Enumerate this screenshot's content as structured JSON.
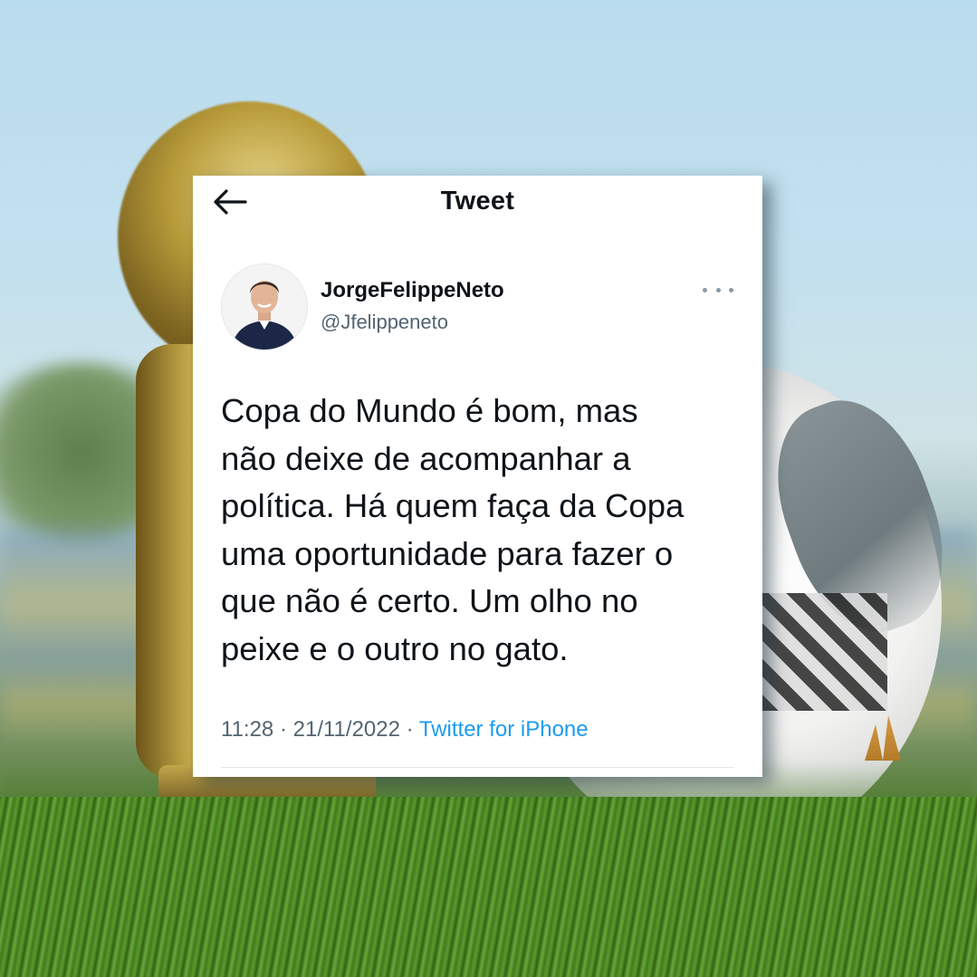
{
  "header": {
    "title": "Tweet"
  },
  "tweet": {
    "author_name": "JorgeFelippeNeto",
    "author_handle": "@Jfelippeneto",
    "text": "Copa do Mundo é bom, mas\nnão deixe de acompanhar a\npolítica. Há quem faça da Copa\numa oportunidade para fazer o\nque não é certo. Um olho no\npeixe e o outro no gato.",
    "time": "11:28",
    "date": "21/11/2022",
    "separator": "·",
    "source": "Twitter for iPhone"
  },
  "icons": {
    "back": "arrow-left-icon",
    "more": "more-horizontal-icon"
  },
  "colors": {
    "link": "#1d9bf0",
    "secondary_text": "#536471",
    "primary_text": "#0f1419"
  }
}
